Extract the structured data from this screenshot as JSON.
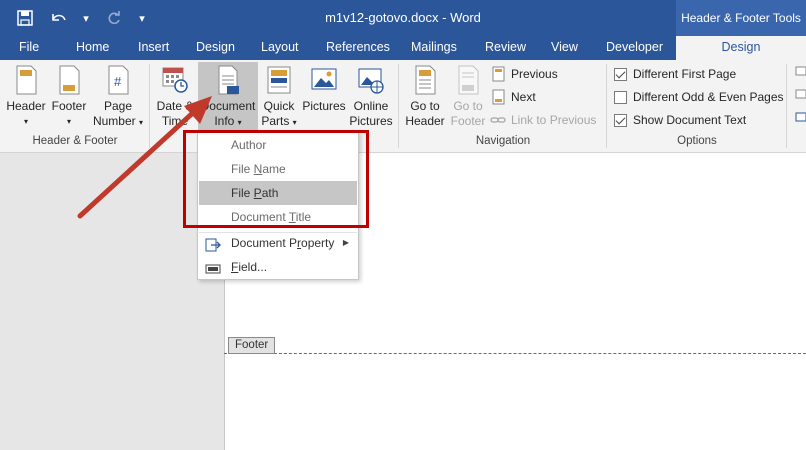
{
  "titlebar": {
    "doc_title": "m1v12-gotovo.docx - Word",
    "contextual_group": "Header & Footer Tools"
  },
  "tabs": [
    "File",
    "Home",
    "Insert",
    "Design",
    "Layout",
    "References",
    "Mailings",
    "Review",
    "View",
    "Developer",
    "Design"
  ],
  "ribbon": {
    "header_footer": {
      "header": "Header",
      "footer": "Footer",
      "page": "Page",
      "number": "Number",
      "group": "Header & Footer"
    },
    "insert": {
      "date": "Date &",
      "time": "Time",
      "document": "Document",
      "info": "Info",
      "quick": "Quick",
      "parts": "Parts",
      "pictures": "Pictures",
      "online": "Online",
      "online_pictures": "Pictures"
    },
    "navigation": {
      "goto": "Go to",
      "header": "Header",
      "goto2": "Go to",
      "footer": "Footer",
      "previous": "Previous",
      "next": "Next",
      "link": "Link to Previous",
      "group": "Navigation"
    },
    "options": {
      "different_first": "Different First Page",
      "different_odd": "Different Odd & Even Pages",
      "show_doc_text": "Show Document Text",
      "group": "Options",
      "different_first_checked": true,
      "different_odd_checked": false,
      "show_doc_text_checked": true
    }
  },
  "menu": {
    "author": "Author",
    "file_name_pre": "File ",
    "file_name_u": "N",
    "file_name_post": "ame",
    "file_path_pre": "File ",
    "file_path_u": "P",
    "file_path_post": "ath",
    "doc_title_pre": "Document ",
    "doc_title_u": "T",
    "doc_title_post": "itle",
    "doc_prop_pre": "Document P",
    "doc_prop_u": "r",
    "doc_prop_post": "operty",
    "field_u": "F",
    "field_post": "ield..."
  },
  "footer_tag": "Footer",
  "colors": {
    "title_blue": "#2b579a",
    "annotation_red": "#c00000",
    "arrow_red": "#c0392b"
  }
}
